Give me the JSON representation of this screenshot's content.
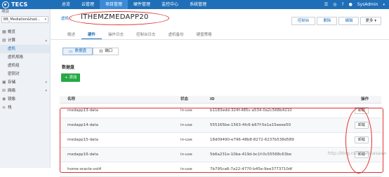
{
  "app": {
    "logo_text": "TECS"
  },
  "topnav": {
    "items": [
      "总览",
      "云管理",
      "项目管理",
      "硬件管理",
      "监控中心",
      "系统管理"
    ],
    "active_index": 2,
    "user": "SysAdmin"
  },
  "sidebar": {
    "title": "项目",
    "project_select": "BB_Mediation&had...",
    "items": [
      {
        "label": "概览",
        "icon": "grid-icon"
      },
      {
        "label": "计算",
        "icon": "compute-icon",
        "expandable": true,
        "open": true
      },
      {
        "label": "虚机",
        "sub": true,
        "active": true
      },
      {
        "label": "虚机规格",
        "sub": true
      },
      {
        "label": "虚机组",
        "sub": true
      },
      {
        "label": "密钥对",
        "sub": true
      },
      {
        "label": "存储",
        "icon": "storage-icon",
        "expandable": true
      },
      {
        "label": "网络",
        "icon": "network-icon",
        "expandable": true
      },
      {
        "label": "镜像",
        "icon": "image-icon"
      },
      {
        "label": "栈",
        "icon": "stack-icon"
      }
    ]
  },
  "header": {
    "breadcrumb": "虚机",
    "breadcrumb_sep": "/",
    "vm_name": "ITHEMZMEDAPP20",
    "actions": [
      "控制台",
      "删除",
      "编辑",
      "更多"
    ]
  },
  "tabs": [
    "概述",
    "硬件",
    "操作日志",
    "控制台日志",
    "虚机备份",
    "硬盘策略"
  ],
  "active_tab": 1,
  "subtabs": [
    {
      "label": "数据盘",
      "icon": "disk-icon",
      "active": true
    },
    {
      "label": "端口",
      "icon": "port-icon",
      "active": false
    }
  ],
  "section_title": "数据盘",
  "add_button": "+ 添加",
  "table": {
    "headers": [
      "名称",
      "状态",
      "ID",
      "操作"
    ],
    "rows": [
      {
        "name": "medapp13-data",
        "status": "in-use",
        "id": "b1183edd-324f-485c-a534-0a2c568b4210",
        "action": "卸载"
      },
      {
        "name": "medapp14-data",
        "status": "in-use",
        "id": "555165be-1563-4fc6-b67f-5e1a15eeee50",
        "action": "卸载"
      },
      {
        "name": "medapp15-data",
        "status": "in-use",
        "id": "18d09490-e796-48b8-8272-6237b538d589",
        "action": "卸载"
      },
      {
        "name": "medapp16-data",
        "status": "in-use",
        "id": "5b6a231e-10ba-419d-bc1f-0c55568c63be",
        "action": "卸载"
      },
      {
        "name": "home-oracle-vol4",
        "status": "in-use",
        "id": "7b795ca6-7a22-4770-b45e-9ee3773710df",
        "action": ""
      }
    ]
  },
  "watermark": "http://blog.csdn.net/kasaaw",
  "colors": {
    "nav_bg": "#1f6fb8",
    "nav_active": "#3a8ad6",
    "add_green": "#27a844",
    "annotation_red": "#e03030"
  }
}
